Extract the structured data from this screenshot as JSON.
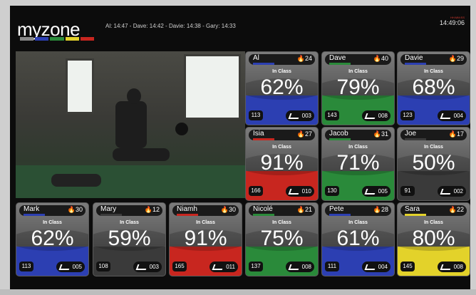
{
  "header": {
    "logo_text": "myzone",
    "ticker": "Al: 14:47 - Dave: 14:42 - Davie: 14:38 - Gary: 14:33",
    "clock_label": "HH:MM:SS",
    "clock": "14:49:06"
  },
  "colors": {
    "blue": "#2c3fb2",
    "green": "#2a8a3a",
    "red": "#c8261f",
    "gray": "#3a3a3a",
    "yellow": "#e3d22a"
  },
  "icons": [
    "myzone-logo-icon",
    "flame-icon",
    "heart-icon",
    "belt-wave-icon"
  ],
  "tiles": [
    {
      "name": "Al",
      "points": "24",
      "status": "In Class",
      "percent": "62%",
      "hr": "113",
      "belt": "003",
      "zone": "blue"
    },
    {
      "name": "Dave",
      "points": "40",
      "status": "In Class",
      "percent": "79%",
      "hr": "143",
      "belt": "008",
      "zone": "green"
    },
    {
      "name": "Davie",
      "points": "29",
      "status": "In Class",
      "percent": "68%",
      "hr": "123",
      "belt": "004",
      "zone": "blue"
    },
    {
      "name": "Isia",
      "points": "27",
      "status": "In Class",
      "percent": "91%",
      "hr": "166",
      "belt": "010",
      "zone": "red"
    },
    {
      "name": "Jacob",
      "points": "31",
      "status": "In Class",
      "percent": "71%",
      "hr": "130",
      "belt": "005",
      "zone": "green"
    },
    {
      "name": "Joe",
      "points": "17",
      "status": "In Class",
      "percent": "50%",
      "hr": "91",
      "belt": "002",
      "zone": "gray"
    },
    {
      "name": "Mark",
      "points": "30",
      "status": "In Class",
      "percent": "62%",
      "hr": "113",
      "belt": "005",
      "zone": "blue"
    },
    {
      "name": "Mary",
      "points": "12",
      "status": "In Class",
      "percent": "59%",
      "hr": "108",
      "belt": "003",
      "zone": "gray"
    },
    {
      "name": "Niamh",
      "points": "30",
      "status": "In Class",
      "percent": "91%",
      "hr": "165",
      "belt": "011",
      "zone": "red"
    },
    {
      "name": "Nicolé",
      "points": "21",
      "status": "In Class",
      "percent": "75%",
      "hr": "137",
      "belt": "008",
      "zone": "green"
    },
    {
      "name": "Pete",
      "points": "28",
      "status": "In Class",
      "percent": "61%",
      "hr": "111",
      "belt": "004",
      "zone": "blue"
    },
    {
      "name": "Sara",
      "points": "22",
      "status": "In Class",
      "percent": "80%",
      "hr": "145",
      "belt": "008",
      "zone": "yellow"
    }
  ]
}
